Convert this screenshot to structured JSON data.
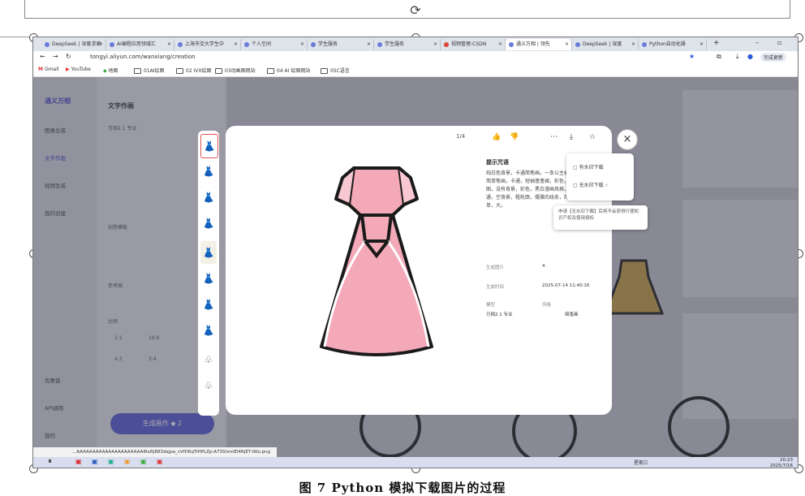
{
  "caption": "图 7 Python 模拟下载图片的过程",
  "browser": {
    "tabs": [
      {
        "label": "DeepSeek | 深度求索"
      },
      {
        "label": "AI编程应用领域汇"
      },
      {
        "label": "上海市交大学生中"
      },
      {
        "label": "个人空间"
      },
      {
        "label": "学生服务"
      },
      {
        "label": "学生服务"
      },
      {
        "label": "视频管理-CSDN"
      },
      {
        "label": "通义万相 | 领先"
      },
      {
        "label": "DeepSeek | 深度"
      },
      {
        "label": "Python自动化操"
      }
    ],
    "url": "tongyi.aliyun.com/wanxiang/creation",
    "update_button": "完成更新",
    "bookmarks": [
      "Gmail",
      "YouTube",
      "地图",
      "01AI绘图",
      "02 IVX绘图",
      "03动画图网站",
      "04 AI 绘图网站",
      "05C语言"
    ]
  },
  "sidebar": {
    "brand": "通义万相",
    "items": [
      "图像生成",
      "文字作画",
      "视频生成",
      "我的创建",
      "优惠值",
      "API调用",
      "我的"
    ]
  },
  "panel": {
    "title": "文字作画",
    "model": "万相2.1 专业",
    "creative_label": "创意模板",
    "reference_label": "参考图",
    "ratio_label": "比例",
    "ratios": [
      "1:1",
      "16:9",
      "4:3",
      "3:4"
    ],
    "generate_button": "生成画作",
    "generate_cost": "2"
  },
  "modal": {
    "counter": "1/4",
    "prompt_title": "提示咒语",
    "prompt_text": "纯白色背景，卡通简笔画，一条公主裙，简单笔画，卡通，短袖蓬蓬裙，彩色，分图，没有背景，彩色，黑白漫画风格，卡通，空背景，粗轮廓，儒雅的线条，简单，大。",
    "meta": [
      {
        "key": "生成图片",
        "value": "4"
      },
      {
        "key": "生成时间",
        "value": "2025-07-14 11:40:16"
      },
      {
        "key": "模型",
        "value": "万相2.1 专业"
      },
      {
        "key": "风格",
        "value": "简笔画"
      }
    ],
    "download_menu": [
      "有水印下载",
      "无水印下载"
    ],
    "tooltip": "申请【无水印下载】后将不会获得行使知识产权及使用授权"
  },
  "statusbar": "...AAAAAAAAAAAAAAAAAAAAAIRxRj883dajpa_cVfD6qTrHPLZp-A73ShmtEl4RjET-0Ko.png",
  "taskbar": {
    "time": "20:23",
    "date": "2025/7/16",
    "weekday": "星期三"
  },
  "colors": {
    "accent": "#5a5fd6",
    "dress_pink": "#f4a9b8",
    "frame": "#777777"
  }
}
